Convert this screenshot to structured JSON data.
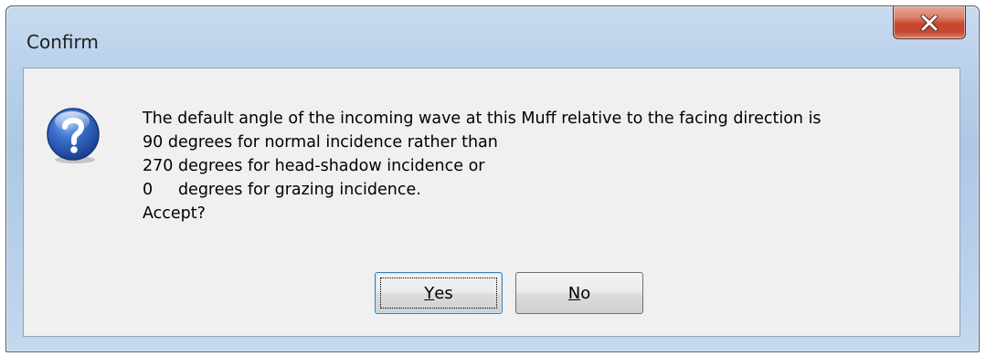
{
  "window": {
    "title": "Confirm"
  },
  "close_icon": "close-icon",
  "dialog": {
    "icon": "question-icon",
    "message_lines": [
      "The default angle of the incoming wave at this Muff relative to the facing direction is",
      "90 degrees for normal incidence rather than",
      "270 degrees for head-shadow incidence or",
      "0     degrees for grazing incidence.",
      "Accept?"
    ]
  },
  "buttons": {
    "yes": {
      "accel": "Y",
      "rest": "es"
    },
    "no": {
      "accel": "N",
      "rest": "o"
    }
  },
  "colors": {
    "close_button": "#c7462b",
    "question_icon": "#2f5fb3",
    "title_bar": "#b9d1ea"
  }
}
